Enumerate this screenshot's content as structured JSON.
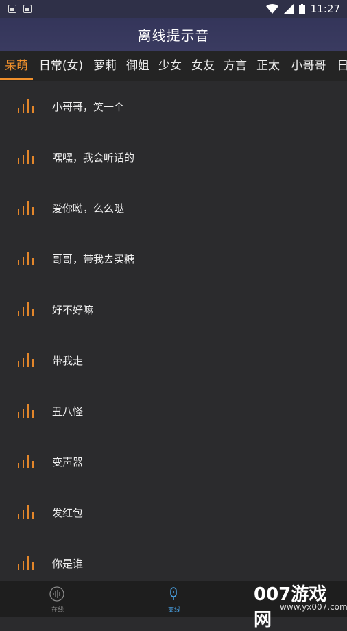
{
  "status_bar": {
    "time": "11:27",
    "left_icons": [
      "gallery-icon",
      "photo-icon"
    ],
    "right_icons": [
      "wifi-icon",
      "signal-icon",
      "battery-icon"
    ]
  },
  "header": {
    "title": "离线提示音"
  },
  "tabs": {
    "items": [
      "呆萌",
      "日常(女)",
      "萝莉",
      "御姐",
      "少女",
      "女友",
      "方言",
      "正太",
      "小哥哥",
      "日"
    ],
    "active_index": 0,
    "accent_color": "#f0902c"
  },
  "list": {
    "items": [
      {
        "label": "小哥哥，笑一个",
        "icon": "audio-wave-icon"
      },
      {
        "label": "嘿嘿，我会听话的",
        "icon": "audio-wave-icon"
      },
      {
        "label": "爱你呦，么么哒",
        "icon": "audio-wave-icon"
      },
      {
        "label": "哥哥，带我去买糖",
        "icon": "audio-wave-icon"
      },
      {
        "label": "好不好嘛",
        "icon": "audio-wave-icon"
      },
      {
        "label": "带我走",
        "icon": "audio-wave-icon"
      },
      {
        "label": "丑八怪",
        "icon": "audio-wave-icon"
      },
      {
        "label": "变声器",
        "icon": "audio-wave-icon"
      },
      {
        "label": "发红包",
        "icon": "audio-wave-icon"
      },
      {
        "label": "你是谁",
        "icon": "audio-wave-icon"
      }
    ]
  },
  "bottom_nav": {
    "items": [
      {
        "label": "在线",
        "icon": "sound-wave-circle-icon"
      },
      {
        "label": "离线",
        "icon": "microphone-icon"
      }
    ],
    "active_index": 1,
    "active_color": "#4aa3e6"
  },
  "watermark": {
    "big": "007游戏网",
    "small": "www.yx007.com"
  }
}
